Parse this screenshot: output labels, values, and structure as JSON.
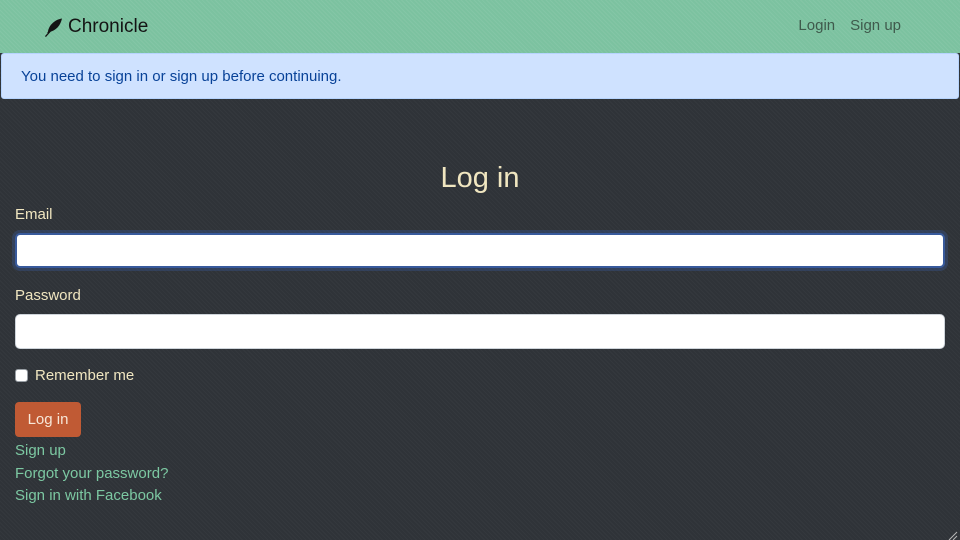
{
  "navbar": {
    "brand": {
      "icon": "feather-icon",
      "label": "Chronicle"
    },
    "links": [
      {
        "label": "Login"
      },
      {
        "label": "Sign up"
      }
    ]
  },
  "alert": {
    "message": "You need to sign in or sign up before continuing."
  },
  "form": {
    "title": "Log in",
    "email": {
      "label": "Email",
      "value": "",
      "placeholder": ""
    },
    "password": {
      "label": "Password",
      "value": "",
      "placeholder": ""
    },
    "remember": {
      "label": "Remember me",
      "checked": false
    },
    "submit_label": "Log in",
    "links": [
      {
        "label": "Sign up"
      },
      {
        "label": "Forgot your password?"
      },
      {
        "label": "Sign in with Facebook"
      }
    ]
  },
  "colors": {
    "navbar_bg": "#7cc2a0",
    "page_bg": "#2f3338",
    "alert_bg": "#cfe2ff",
    "alert_text": "#084298",
    "heading_text": "#f0e6c0",
    "link": "#7cc8a2",
    "button_bg": "#c05a34"
  }
}
